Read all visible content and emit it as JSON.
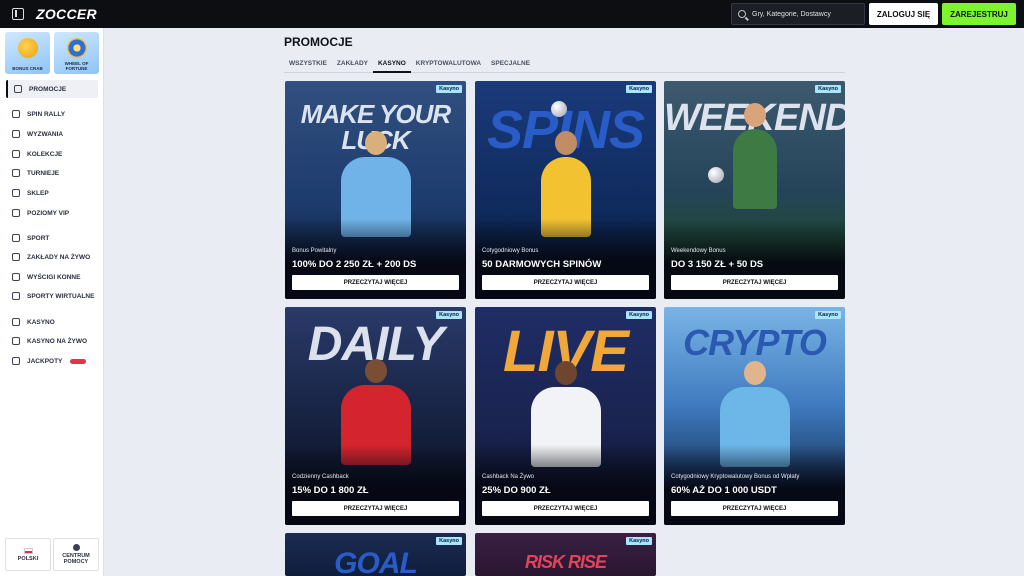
{
  "header": {
    "logo": "ZOCCER",
    "search_placeholder": "Gry, Kategorie, Dostawcy",
    "login_label": "ZALOGUJ SIĘ",
    "register_label": "ZAREJESTRUJ"
  },
  "sidebar": {
    "promo_tiles": [
      {
        "label": "BONUS CRAB",
        "icon": "coin-icon"
      },
      {
        "label": "WHEEL OF FORTUNE",
        "icon": "wheel-icon"
      }
    ],
    "items": [
      {
        "label": "PROMOCJE",
        "icon": "gift-icon"
      },
      {
        "label": "SPIN RALLY",
        "icon": "flag-icon"
      },
      {
        "label": "WYZWANIA",
        "icon": "target-icon"
      },
      {
        "label": "KOLEKCJE",
        "icon": "collection-icon"
      },
      {
        "label": "TURNIEJE",
        "icon": "podium-icon"
      },
      {
        "label": "SKLEP",
        "icon": "basket-icon"
      },
      {
        "label": "POZIOMY VIP",
        "icon": "shield-icon"
      },
      {
        "label": "SPORT",
        "icon": "ball-icon"
      },
      {
        "label": "ZAKŁADY NA ŻYWO",
        "icon": "live-icon"
      },
      {
        "label": "WYŚCIGI KONNE",
        "icon": "horse-icon"
      },
      {
        "label": "SPORTY WIRTUALNE",
        "icon": "car-icon"
      },
      {
        "label": "KASYNO",
        "icon": "casino-icon"
      },
      {
        "label": "KASYNO NA ŻYWO",
        "icon": "dealer-icon"
      },
      {
        "label": "JACKPOTY",
        "icon": "magnet-icon"
      }
    ],
    "footer": {
      "language_label": "POLSKI",
      "help_label": "CENTRUM POMOCY"
    }
  },
  "main": {
    "title": "PROMOCJE",
    "tabs": [
      "WSZYSTKIE",
      "ZAKŁADY",
      "KASYNO",
      "KRYPTOWALUTOWA",
      "SPECJALNE"
    ],
    "active_tab": "KASYNO",
    "cards": [
      {
        "tag": "Kasyno",
        "big_text": "MAKE YOUR LUCK",
        "subtitle": "Bonus Powitalny",
        "amount": "100% DO 2 250 ZŁ + 200 DS",
        "button": "PRZECZYTAJ WIĘCEJ",
        "bg": "#1d3c6e"
      },
      {
        "tag": "Kasyno",
        "big_text": "SPINS",
        "subtitle": "Cotygodniowy Bonus",
        "amount": "50 DARMOWYCH SPINÓW",
        "button": "PRZECZYTAJ WIĘCEJ",
        "bg": "#0f2a5c"
      },
      {
        "tag": "Kasyno",
        "big_text": "WEEKEND",
        "subtitle": "Weekendowy Bonus",
        "amount": "DO 3 150 ZŁ + 50 DS",
        "button": "PRZECZYTAJ WIĘCEJ",
        "bg": "#1f3a4d"
      },
      {
        "tag": "Kasyno",
        "big_text": "DAILY",
        "subtitle": "Codzienny Cashback",
        "amount": "15% DO 1 800 ZŁ",
        "button": "PRZECZYTAJ WIĘCEJ",
        "bg": "#16213f"
      },
      {
        "tag": "Kasyno",
        "big_text": "LIVE",
        "subtitle": "Cashback Na Żywo",
        "amount": "25% DO 900 ZŁ",
        "button": "PRZECZYTAJ WIĘCEJ",
        "bg": "#1a2450"
      },
      {
        "tag": "Kasyno",
        "big_text": "CRYPTO",
        "subtitle": "Cotygodniowy Kryptowalutowy Bonus od Wpłaty",
        "amount": "60% AŻ DO 1 000 USDT",
        "button": "PRZECZYTAJ WIĘCEJ",
        "bg": "#3f7bbf"
      },
      {
        "tag": "Kasyno",
        "big_text": "GOAL",
        "bg": "#0f1e3c"
      },
      {
        "tag": "Kasyno",
        "big_text": "RISK RISE",
        "bg": "#2a1630"
      }
    ]
  },
  "colors": {
    "accent_green": "#7cf530",
    "topbar": "#0d0e12",
    "page_bg": "#e9ecf2",
    "tag_bg": "#a8e6ff"
  }
}
